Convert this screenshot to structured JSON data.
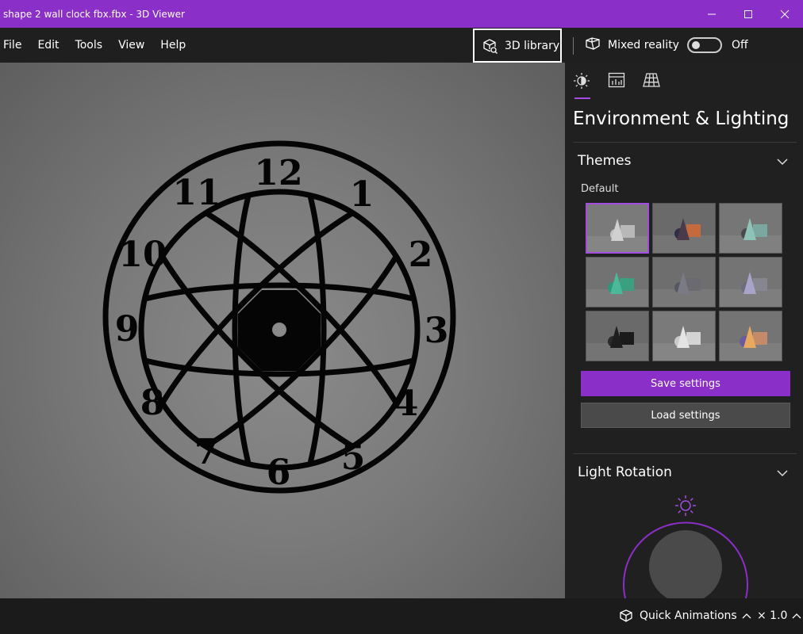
{
  "window": {
    "title": "shape 2 wall clock fbx.fbx - 3D Viewer",
    "accent_color": "#8a2fc7"
  },
  "menu": {
    "items": [
      "File",
      "Edit",
      "Tools",
      "View",
      "Help"
    ],
    "library_label": "3D library",
    "mixed_reality_label": "Mixed reality",
    "mixed_reality_state": "Off"
  },
  "viewport": {
    "model": "wall-clock",
    "clock_numerals": [
      "12",
      "1",
      "2",
      "3",
      "4",
      "5",
      "6",
      "7",
      "8",
      "9",
      "10",
      "11"
    ]
  },
  "panel": {
    "tabs": [
      {
        "icon": "lighting-icon",
        "active": true
      },
      {
        "icon": "stats-icon",
        "active": false
      },
      {
        "icon": "grid-icon",
        "active": false
      }
    ],
    "title": "Environment & Lighting",
    "themes": {
      "header": "Themes",
      "selected_label": "Default",
      "selected_index": 0
    },
    "save_label": "Save settings",
    "load_label": "Load settings",
    "light_rotation_header": "Light Rotation"
  },
  "status": {
    "animations_label": "Quick Animations",
    "speed": "× 1.0"
  }
}
